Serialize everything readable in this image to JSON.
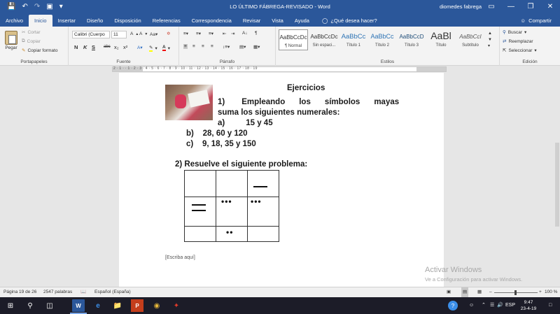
{
  "window": {
    "title": "LO ÚLTIMO FÁBREGA-REVISADO  -  Word",
    "user": "diomedes fabrega",
    "qat_icons": [
      "save-icon",
      "undo-icon",
      "redo-icon",
      "touch-mode-icon",
      "customize-qat-icon"
    ],
    "controls": [
      "ribbon-display-icon",
      "minimize-icon",
      "restore-icon",
      "close-icon"
    ]
  },
  "tabs": [
    "Archivo",
    "Inicio",
    "Insertar",
    "Diseño",
    "Disposición",
    "Referencias",
    "Correspondencia",
    "Revisar",
    "Vista",
    "Ayuda"
  ],
  "tell_me": "¿Qué desea hacer?",
  "share": "Compartir",
  "ribbon": {
    "clipboard": {
      "label": "Portapapeles",
      "paste": "Pegar",
      "cut": "Cortar",
      "copy": "Copiar",
      "format_painter": "Copiar formato"
    },
    "font": {
      "label": "Fuente",
      "font_name": "Calibri (Cuerpo",
      "font_size": "11",
      "bold": "N",
      "italic": "K",
      "underline": "S",
      "strike": "abc",
      "sub": "x₂",
      "sup": "x²"
    },
    "paragraph": {
      "label": "Párrafo"
    },
    "styles": {
      "label": "Estilos",
      "items": [
        {
          "sample": "AaBbCcDc",
          "name": "¶ Normal"
        },
        {
          "sample": "AaBbCcDc",
          "name": "Sin espaci..."
        },
        {
          "sample": "AaBbCc",
          "name": "Título 1"
        },
        {
          "sample": "AaBbCc",
          "name": "Título 2"
        },
        {
          "sample": "AaBbCcD",
          "name": "Título 3"
        },
        {
          "sample": "AaBl",
          "name": "Título"
        },
        {
          "sample": "AaBbCcI",
          "name": "Subtítulo"
        }
      ]
    },
    "editing": {
      "label": "Edición",
      "find": "Buscar",
      "replace": "Reemplazar",
      "select": "Seleccionar"
    }
  },
  "ruler_numbers": "2 · 1 · · 1 · 2 · 3 · 4 · 5 · 6 · 7 · 8 · 9 · 10 · 11 · 12 · 13 · 14 · 15 · 16 · 17 · 18 · 19",
  "document": {
    "heading": "Ejercicios",
    "q1_words": [
      "1)",
      "Empleando",
      "los",
      "símbolos",
      "mayas"
    ],
    "q1_line2": "suma los siguientes numerales:",
    "item_a_label": "a)",
    "item_a_value": "15 y 45",
    "item_b": "b)    28, 60 y 120",
    "item_c": "c)    9, 18, 35 y 150",
    "q2": "2) Resuelve el siguiente problema:",
    "placeholder": "[Escriba aquí]",
    "maya_table": [
      [
        {
          "bars": 0,
          "dots": 0
        },
        {
          "bars": 0,
          "dots": 0
        },
        {
          "bars": 1,
          "dots": 0
        }
      ],
      [
        {
          "bars": 2,
          "dots": 0
        },
        {
          "bars": 0,
          "dots": 3
        },
        {
          "bars": 0,
          "dots": 3
        }
      ],
      [
        {
          "bars": 0,
          "dots": 0
        },
        {
          "bars": 0,
          "dots": 2
        },
        {
          "bars": 0,
          "dots": 0
        }
      ]
    ]
  },
  "watermark": {
    "line1": "Activar Windows",
    "line2": "Ve a Configuración para activar Windows."
  },
  "status": {
    "page": "Página 19 de 26",
    "words": "2547 palabras",
    "language": "Español (España)",
    "zoom": "100 %"
  },
  "taskbar": {
    "lang": "ESP",
    "time": "9:47",
    "date": "23-4-19"
  }
}
